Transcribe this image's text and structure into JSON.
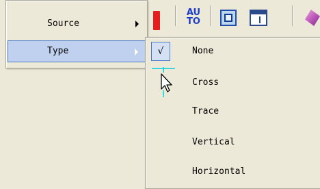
{
  "toolbar": {
    "buttons": [
      {
        "icon": "red-bar-icon"
      },
      {
        "icon": "auto-icon",
        "text_top": "AU",
        "text_bottom": "TO"
      },
      {
        "icon": "frame-icon"
      },
      {
        "icon": "window-icon"
      },
      {
        "icon": "eraser-icon"
      }
    ],
    "auto_color": "#1A3CC8"
  },
  "main_menu": {
    "items": [
      {
        "label": "Source",
        "has_submenu": true,
        "highlighted": false
      },
      {
        "label": "Type",
        "has_submenu": true,
        "highlighted": true
      }
    ]
  },
  "type_submenu": {
    "items": [
      {
        "label": "None",
        "checked": true,
        "check_glyph": "√"
      },
      {
        "label": "Cross",
        "checked": false
      },
      {
        "label": "Trace",
        "checked": false
      },
      {
        "label": "Vertical",
        "checked": false
      },
      {
        "label": "Horizontal",
        "checked": false
      }
    ]
  },
  "colors": {
    "menu_bg": "#ECE9D8",
    "highlight_bg": "#BFD1EE",
    "highlight_border": "#4D78C6",
    "cursor_accent": "#00D0E0"
  }
}
